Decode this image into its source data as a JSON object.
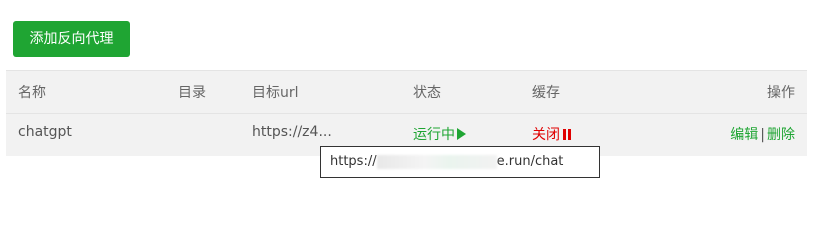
{
  "toolbar": {
    "add_button_label": "添加反向代理"
  },
  "table": {
    "headers": {
      "name": "名称",
      "directory": "目录",
      "target_url": "目标url",
      "status": "状态",
      "cache": "缓存",
      "operations": "操作"
    },
    "rows": [
      {
        "name": "chatgpt",
        "directory": "",
        "target_url": "https://z4...",
        "status": "运行中",
        "cache": "关闭",
        "edit_label": "编辑",
        "separator": "|",
        "delete_label": "删除"
      }
    ]
  },
  "tooltip": {
    "prefix": "https://",
    "suffix": "e.run/chat"
  },
  "colors": {
    "accent_green": "#1fa533",
    "stop_red": "#e00000",
    "table_bg": "#f2f2f2"
  },
  "icons": {
    "status": "play-icon",
    "cache": "pause-icon"
  }
}
